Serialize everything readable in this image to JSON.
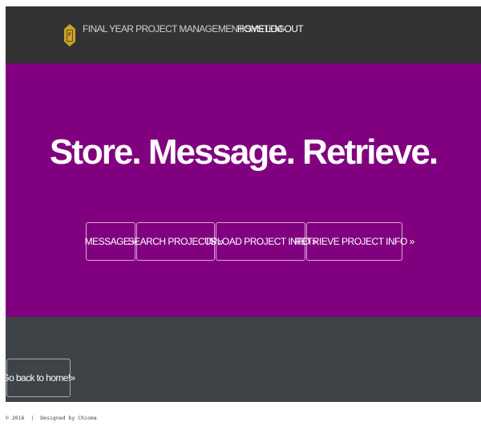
{
  "navbar": {
    "brand": "FINAL YEAR PROJECT MANAGEMENT SYSTEM",
    "logo_letter": "F",
    "links": [
      {
        "label": "HOME"
      },
      {
        "label": "LOGOUT"
      }
    ]
  },
  "hero": {
    "title": "Store. Message. Retrieve.",
    "buttons": [
      {
        "label": "MESSAGE »"
      },
      {
        "label": "SEARCH PROJECTS »"
      },
      {
        "label": "UPLOAD PROJECT INFO »"
      },
      {
        "label": "RETRIEVE PROJECT INFO »"
      }
    ]
  },
  "lower": {
    "back_button": "Go back to home!»"
  },
  "footer": {
    "copyright": "© 2016",
    "separator": "|",
    "credit": "Designed by Chioma"
  },
  "colors": {
    "navbar": "#333333",
    "hero": "#800080",
    "lower_section": "#3d4346",
    "logo": "#c9a227"
  }
}
